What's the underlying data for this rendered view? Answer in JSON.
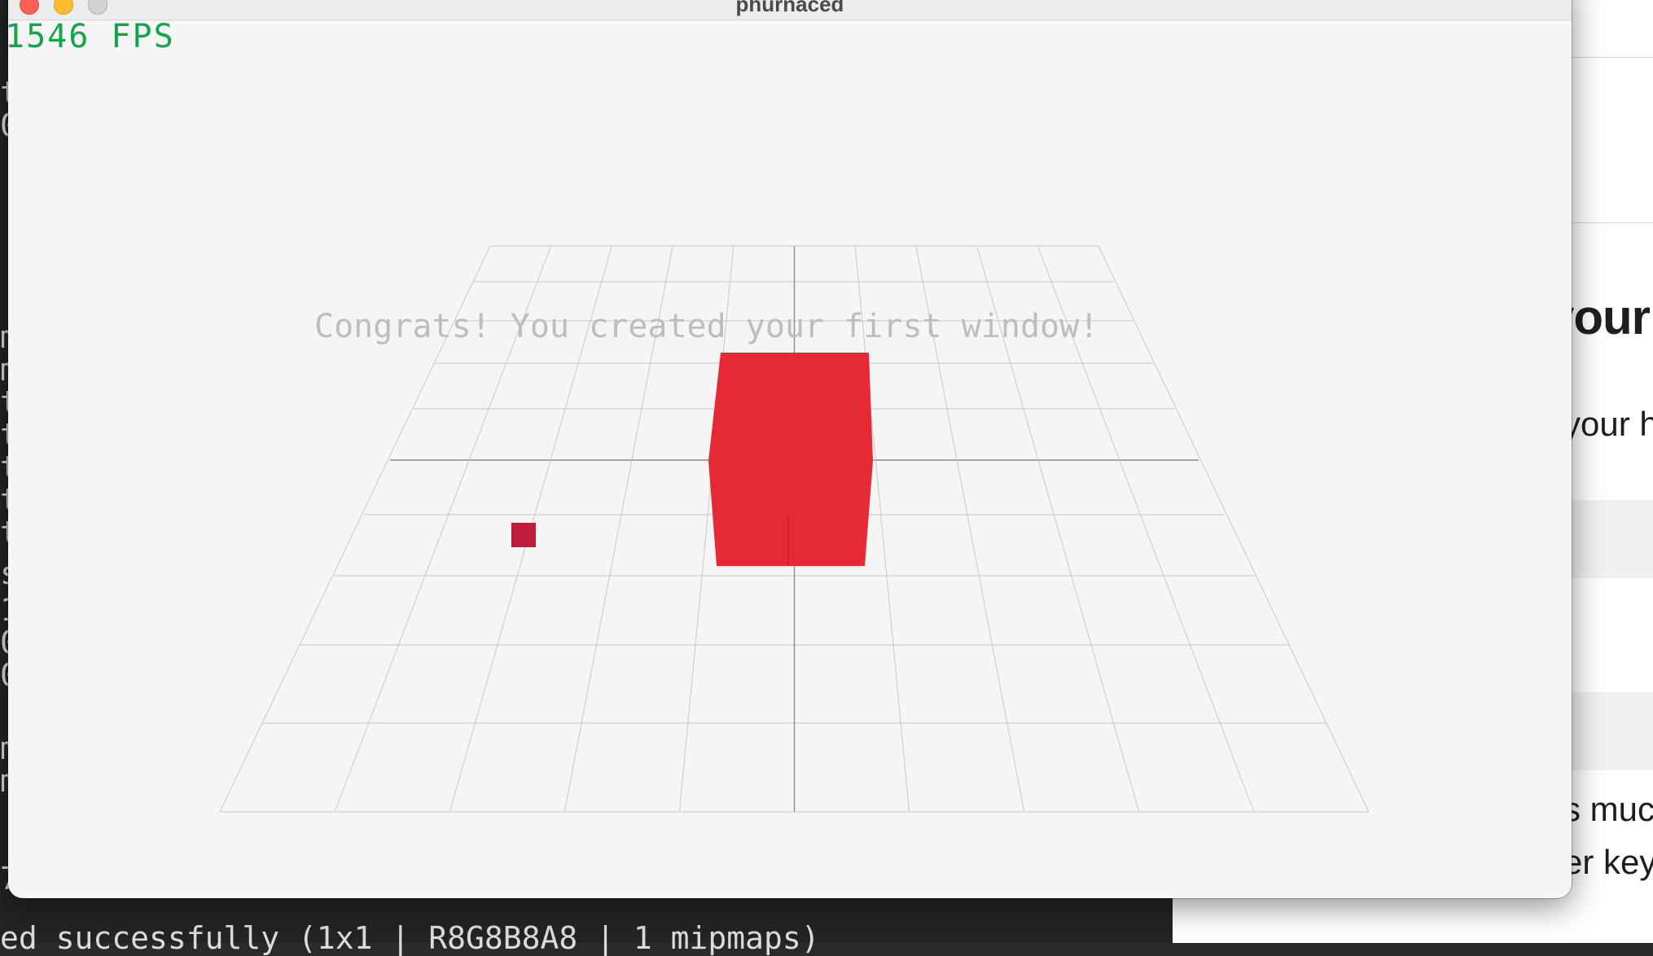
{
  "window": {
    "title": "phurnaced",
    "fps_text": "1546 FPS",
    "overlay_text": "Congrats! You created your first window!"
  },
  "scene": {
    "cube_color": "#e52a36",
    "small_square_color": "#be1e3c",
    "grid_color": "#c8c8c8",
    "axis_color": "#8a8a8a",
    "background": "#f5f5f5"
  },
  "terminal": {
    "line_fragments": [
      "t",
      "0",
      "m",
      "m",
      "t",
      "t",
      "t",
      "t",
      "t",
      "s",
      "1",
      "0",
      "0",
      "m",
      "m",
      "7"
    ],
    "bottom_line": "ed successfully (1x1 | R8G8B8A8 | 1 mipmaps)"
  },
  "webpage": {
    "heading_fragment": "your",
    "text_fragments": [
      "your h",
      "s muc",
      "er key"
    ]
  }
}
